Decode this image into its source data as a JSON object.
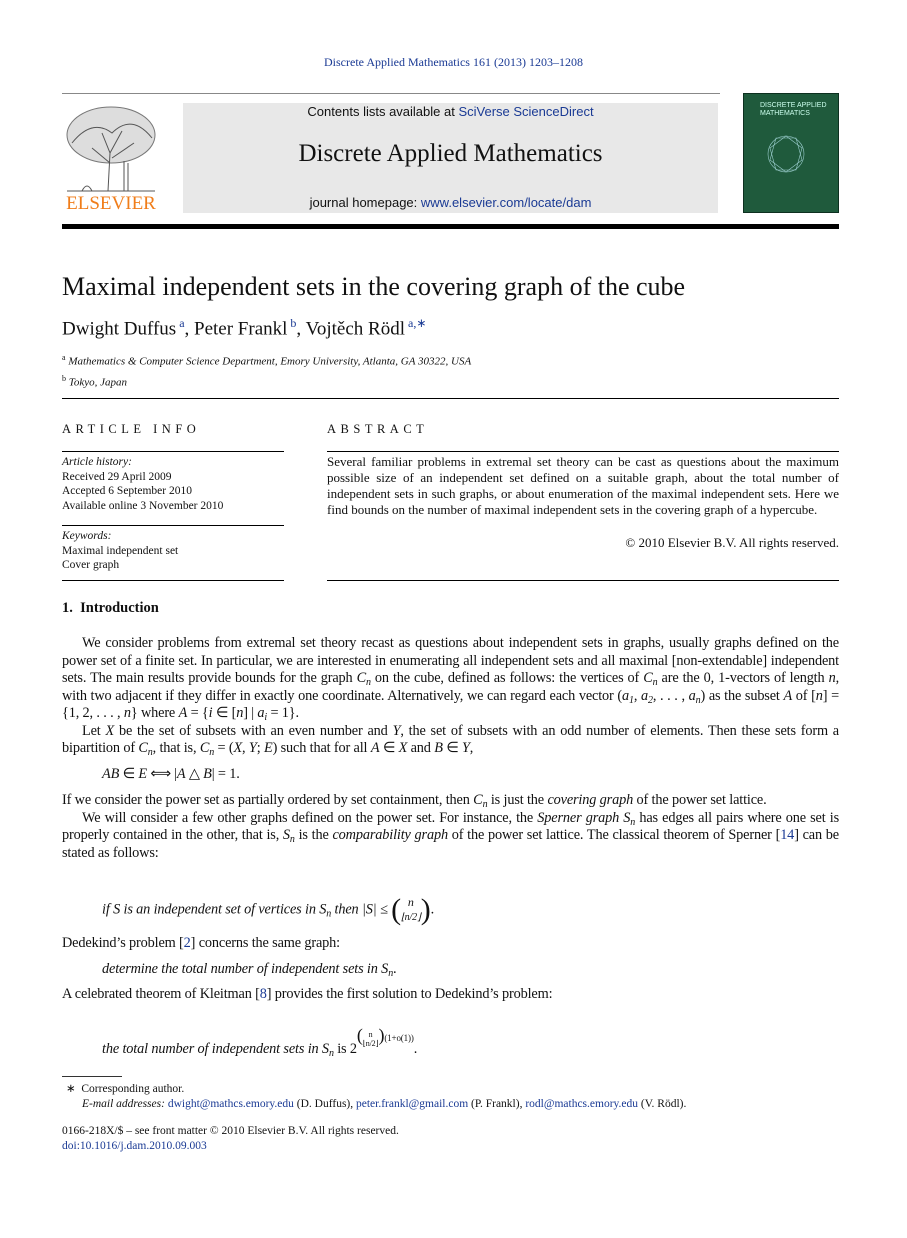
{
  "journal_ref": "Discrete Applied Mathematics 161 (2013) 1203–1208",
  "header": {
    "contents_prefix": "Contents lists available at ",
    "contents_link": "SciVerse ScienceDirect",
    "journal_title": "Discrete Applied Mathematics",
    "homepage_prefix": "journal homepage: ",
    "homepage_link": "www.elsevier.com/locate/dam",
    "publisher_logo": "ELSEVIER",
    "cover_title": "DISCRETE APPLIED MATHEMATICS",
    "colors": {
      "link": "#1a3a94",
      "elsevier_orange": "#f07d1a",
      "cover_green": "#1f5a3c",
      "banner_bg": "#e8e8e8"
    }
  },
  "title": "Maximal independent sets in the covering graph of the cube",
  "authors": [
    {
      "name": "Dwight Duffus",
      "sup": "a"
    },
    {
      "name": "Peter Frankl",
      "sup": "b"
    },
    {
      "name": "Vojtěch Rödl",
      "sup": "a,∗"
    }
  ],
  "affiliations": [
    {
      "sup": "a",
      "text": "Mathematics & Computer Science Department, Emory University, Atlanta, GA 30322, USA"
    },
    {
      "sup": "b",
      "text": "Tokyo, Japan"
    }
  ],
  "article_info": {
    "heading": "ARTICLE INFO",
    "history_label": "Article history:",
    "history": [
      "Received 29 April 2009",
      "Accepted 6 September 2010",
      "Available online 3 November 2010"
    ],
    "keywords_label": "Keywords:",
    "keywords": [
      "Maximal independent set",
      "Cover graph"
    ]
  },
  "abstract": {
    "heading": "ABSTRACT",
    "text": "Several familiar problems in extremal set theory can be cast as questions about the maximum possible size of an independent set defined on a suitable graph, about the total number of independent sets in such graphs, or about enumeration of the maximal independent sets. Here we find bounds on the number of maximal independent sets in the covering graph of a hypercube.",
    "copyright": "© 2010 Elsevier B.V. All rights reserved."
  },
  "section": {
    "number": "1.",
    "title": "Introduction"
  },
  "paragraphs": [
    {
      "indent": true,
      "segs": [
        [
          "We consider problems from extremal set theory recast as questions about independent sets in graphs, usually graphs defined on the power set of a finite set. In particular, we are interested in enumerating all independent sets and all maximal [non-extendable] independent sets. The main results provide bounds for the graph "
        ],
        [
          "C",
          "i"
        ],
        [
          "n",
          "sub"
        ],
        [
          " on the cube, defined as follows: the vertices of "
        ],
        [
          "C",
          "i"
        ],
        [
          "n",
          "sub"
        ],
        [
          " are the 0, 1-vectors of length "
        ],
        [
          "n",
          "i"
        ],
        [
          ", with two adjacent if they differ in exactly one coordinate. Alternatively, we can regard each vector ("
        ],
        [
          "a",
          "i"
        ],
        [
          "1",
          "sub"
        ],
        [
          ", "
        ],
        [
          "a",
          "i"
        ],
        [
          "2",
          "sub"
        ],
        [
          ", . . . , "
        ],
        [
          "a",
          "i"
        ],
        [
          "n",
          "sub"
        ],
        [
          ") as the subset "
        ],
        [
          "A",
          "i"
        ],
        [
          " of ["
        ],
        [
          "n",
          "i"
        ],
        [
          "] = {1, 2, . . . , "
        ],
        [
          "n",
          "i"
        ],
        [
          "} where "
        ],
        [
          "A",
          "i"
        ],
        [
          " = {"
        ],
        [
          "i",
          "i"
        ],
        [
          " ∈ ["
        ],
        [
          "n",
          "i"
        ],
        [
          "] | "
        ],
        [
          "a",
          "i"
        ],
        [
          "i",
          "sub"
        ],
        [
          " = 1}."
        ]
      ]
    },
    {
      "indent": true,
      "segs": [
        [
          "Let "
        ],
        [
          "X",
          "i"
        ],
        [
          " be the set of subsets with an even number and "
        ],
        [
          "Y",
          "i"
        ],
        [
          ", the set of subsets with an odd number of elements. Then these sets form a bipartition of "
        ],
        [
          "C",
          "i"
        ],
        [
          "n",
          "sub"
        ],
        [
          ", that is, "
        ],
        [
          "C",
          "i"
        ],
        [
          "n",
          "sub"
        ],
        [
          " = ("
        ],
        [
          "X",
          "i"
        ],
        [
          ", "
        ],
        [
          "Y",
          "i"
        ],
        [
          "; "
        ],
        [
          "E",
          "i"
        ],
        [
          ") such that for all "
        ],
        [
          "A",
          "i"
        ],
        [
          " ∈ "
        ],
        [
          "X",
          "i"
        ],
        [
          " and "
        ],
        [
          "B",
          "i"
        ],
        [
          " ∈ "
        ],
        [
          "Y",
          "i"
        ],
        [
          ","
        ]
      ]
    },
    {
      "display": true,
      "segs": [
        [
          "AB",
          "i"
        ],
        [
          " ∈ "
        ],
        [
          "E",
          "i"
        ],
        [
          "  ⟺  |"
        ],
        [
          "A",
          "i"
        ],
        [
          " △ "
        ],
        [
          "B",
          "i"
        ],
        [
          "| = 1."
        ]
      ]
    },
    {
      "indent": false,
      "segs": [
        [
          "If we consider the power set as partially ordered by set containment, then "
        ],
        [
          "C",
          "i"
        ],
        [
          "n",
          "sub"
        ],
        [
          " is just the "
        ],
        [
          "covering graph",
          "i"
        ],
        [
          " of the power set lattice."
        ]
      ]
    },
    {
      "indent": true,
      "segs": [
        [
          "We will consider a few other graphs defined on the power set. For instance, the "
        ],
        [
          "Sperner graph S",
          "i"
        ],
        [
          "n",
          "sub"
        ],
        [
          " has edges all pairs where one set is properly contained in the other, that is, "
        ],
        [
          "S",
          "i"
        ],
        [
          "n",
          "sub"
        ],
        [
          " is the "
        ],
        [
          "comparability graph",
          "i"
        ],
        [
          " of the power set lattice. The classical theorem of Sperner ["
        ],
        [
          "14",
          "link"
        ],
        [
          "] can be stated as follows:"
        ]
      ]
    }
  ],
  "sperner_stmt": {
    "text": "if S is an independent set of vertices in S",
    "sub": "n",
    "then": " then |S| ≤ ",
    "binom_top": "n",
    "binom_bottom": "⌊n/2⌋",
    "end": "."
  },
  "dedekind": {
    "pre": "Dedekind’s problem [",
    "ref": "2",
    "post": "] concerns the same graph:",
    "stmt": "determine the total number of independent sets in S",
    "sub": "n",
    "end": "."
  },
  "kleitman": {
    "pre": "A celebrated theorem of Kleitman [",
    "ref": "8",
    "post": "] provides the first solution to Dedekind’s problem:",
    "stmt": "the total number of independent sets in S",
    "sub": "n",
    "is": " is 2",
    "exp_binom_top": "n",
    "exp_binom_bottom": "⌊n/2⌋",
    "exp_rest": "(1+o(1))",
    "end": "."
  },
  "footnote": {
    "star": "∗",
    "corresponding": "Corresponding author.",
    "email_label": "E-mail addresses: ",
    "emails": [
      {
        "addr": "dwight@mathcs.emory.edu",
        "who": " (D. Duffus), "
      },
      {
        "addr": "peter.frankl@gmail.com",
        "who": " (P. Frankl), "
      },
      {
        "addr": "rodl@mathcs.emory.edu",
        "who": " (V. Rödl)."
      }
    ]
  },
  "front_matter": "0166-218X/$ – see front matter © 2010 Elsevier B.V. All rights reserved.",
  "doi": "doi:10.1016/j.dam.2010.09.003"
}
